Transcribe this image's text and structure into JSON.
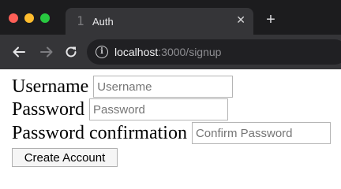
{
  "window": {
    "traffic_lights": {
      "close": "#fe5f57",
      "minimize": "#febc2e",
      "zoom": "#28c840"
    }
  },
  "tab": {
    "favicon_glyph": "1",
    "title": "Auth",
    "close_glyph": "✕"
  },
  "toolbar": {
    "new_tab_glyph": "+",
    "url_host": "localhost",
    "url_rest": ":3000/signup",
    "info_glyph": "i"
  },
  "form": {
    "username_label": "Username",
    "username_placeholder": "Username",
    "password_label": "Password",
    "password_placeholder": "Password",
    "confirm_label": "Password confirmation",
    "confirm_placeholder": "Confirm Password",
    "submit_label": "Create Account"
  }
}
